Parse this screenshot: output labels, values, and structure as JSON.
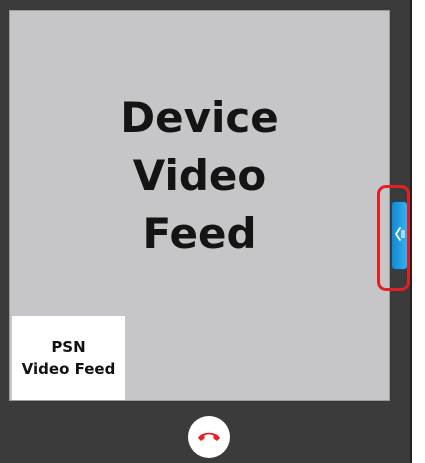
{
  "main_video": {
    "label": "Device\nVideo\nFeed"
  },
  "self_view": {
    "label": "PSN\nVideo Feed"
  },
  "side_panel_tab": {
    "icon": "chevron-left-icon",
    "color": "#1e9be3",
    "highlight_color": "#e02025"
  },
  "controls": {
    "end_call_icon": "phone-hangup-icon",
    "end_call_color": "#e8202a"
  }
}
